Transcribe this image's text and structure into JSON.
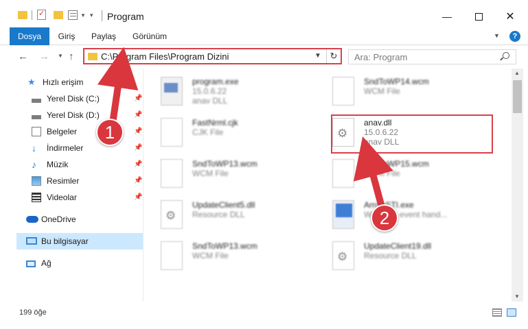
{
  "window": {
    "title": "Program",
    "minimize_label": "—",
    "close_label": "✕"
  },
  "ribbon": {
    "tabs": [
      "Dosya",
      "Giriş",
      "Paylaş",
      "Görünüm"
    ]
  },
  "navigation": {
    "address": "C:\\Program Files\\Program Dizini",
    "search_placeholder": "Ara: Program",
    "back_glyph": "←",
    "forward_glyph": "→",
    "up_glyph": "↑"
  },
  "sidebar": {
    "items": [
      {
        "label": "Hızlı erişim",
        "icon": "star-icon"
      },
      {
        "label": "Yerel Disk (C:)",
        "icon": "drive-icon"
      },
      {
        "label": "Yerel Disk (D:)",
        "icon": "drive-icon"
      },
      {
        "label": "Belgeler",
        "icon": "documents-icon"
      },
      {
        "label": "İndirmeler",
        "icon": "download-icon"
      },
      {
        "label": "Müzik",
        "icon": "music-icon"
      },
      {
        "label": "Resimler",
        "icon": "pictures-icon"
      },
      {
        "label": "Videolar",
        "icon": "videos-icon"
      },
      {
        "label": "OneDrive",
        "icon": "cloud-icon"
      },
      {
        "label": "Bu bilgisayar",
        "icon": "computer-icon"
      },
      {
        "label": "Ağ",
        "icon": "network-icon"
      }
    ],
    "selected": "Bu bilgisayar"
  },
  "files": [
    {
      "name": "program.exe",
      "line1": "15.0.6.22",
      "line2": "anav DLL",
      "icon": "exe-icon"
    },
    {
      "name": "SndToWP14.wcm",
      "line1": "WCM File",
      "line2": "",
      "icon": "file-icon"
    },
    {
      "name": "FastNrml.cjk",
      "line1": "CJK File",
      "line2": "",
      "icon": "file-icon"
    },
    {
      "name": "anav.dll",
      "line1": "15.0.6.22",
      "line2": "anav DLL",
      "icon": "dll-gear-icon"
    },
    {
      "name": "SndToWP13.wcm",
      "line1": "WCM File",
      "line2": "",
      "icon": "file-icon"
    },
    {
      "name": "SndToWP15.wcm",
      "line1": "WCM File",
      "line2": "",
      "icon": "file-icon"
    },
    {
      "name": "UpdateClient5.dll",
      "line1": "Resource DLL",
      "line2": "",
      "icon": "dll-gear-icon"
    },
    {
      "name": "ArrowSTI.exe",
      "line1": "Windows event hand...",
      "line2": "",
      "icon": "app-window-icon"
    },
    {
      "name": "SndToWP13.wcm",
      "line1": "WCM File",
      "line2": "",
      "icon": "file-icon"
    },
    {
      "name": "UpdateClient19.dll",
      "line1": "Resource DLL",
      "line2": "",
      "icon": "dll-gear-icon"
    }
  ],
  "status": {
    "item_count": "199 öğe"
  },
  "annotations": {
    "step1": "1",
    "step2": "2",
    "color": "#d9363e"
  },
  "colors": {
    "accent": "#1979ca",
    "selection": "#cce8ff",
    "highlight_border": "#d9404a"
  }
}
